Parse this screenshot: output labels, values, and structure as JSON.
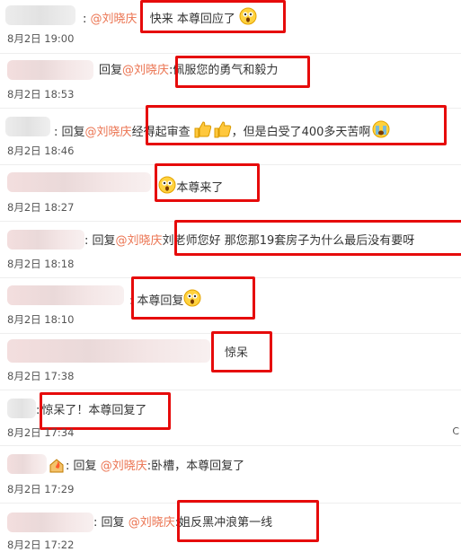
{
  "comments": [
    {
      "reply_prefix": "",
      "mention": "@刘晓庆",
      "text": "快来 本尊回应了",
      "time": "8月2日 19:00"
    },
    {
      "reply_prefix": "回复",
      "mention": "@刘晓庆",
      "text": "佩服您的勇气和毅力",
      "time": "8月2日 18:53"
    },
    {
      "reply_prefix": "回复",
      "mention": "@刘晓庆",
      "text": "经得起审查",
      "text_after": "，但是白受了400多天苦啊",
      "time": "8月2日 18:46"
    },
    {
      "reply_prefix": "",
      "mention": "",
      "text": "本尊来了",
      "time": "8月2日 18:27"
    },
    {
      "reply_prefix": "回复",
      "mention": "@刘晓庆",
      "text": "刘老师您好  那您那19套房子为什么最后没有要呀",
      "time": "8月2日 18:18"
    },
    {
      "reply_prefix": "",
      "mention": "",
      "text": "本尊回复",
      "time": "8月2日 18:10"
    },
    {
      "reply_prefix": "",
      "mention": "",
      "text": "惊呆",
      "time": "8月2日 17:38"
    },
    {
      "reply_prefix": "",
      "mention": "",
      "text": "惊呆了！本尊回复了",
      "time": "8月2日 17:34"
    },
    {
      "reply_prefix": "回复",
      "mention": "@刘晓庆",
      "text": "卧槽，本尊回复了",
      "time": "8月2日 17:29"
    },
    {
      "reply_prefix": "回复",
      "mention": "@刘晓庆",
      "text": "姐反黑冲浪第一线",
      "time": "8月2日 17:22"
    }
  ],
  "colon": ":",
  "colon_fw": "：",
  "highlight_color": "#e60b0b",
  "mention_color": "#eb7350"
}
